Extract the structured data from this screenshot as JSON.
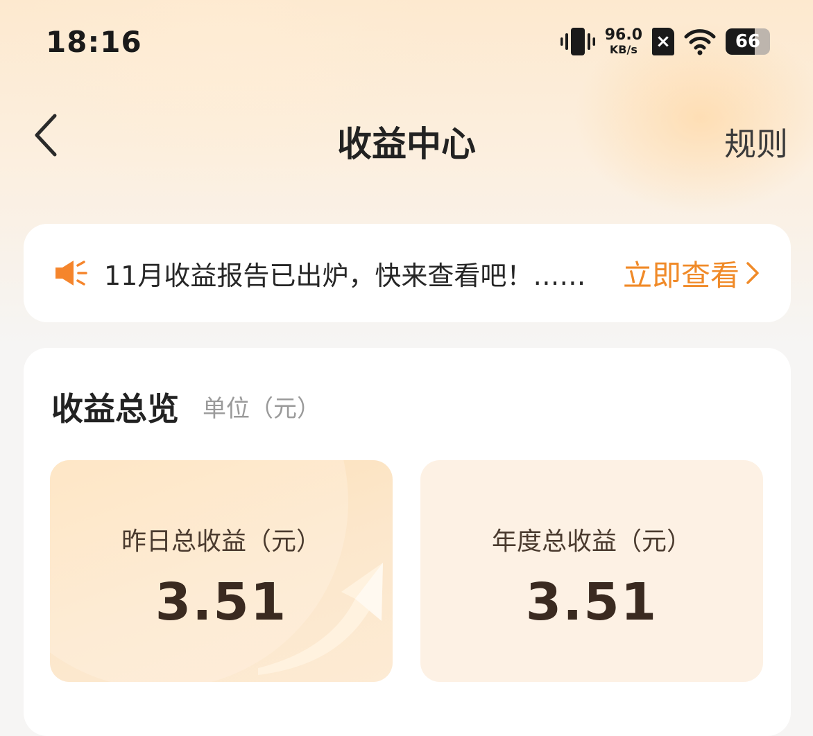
{
  "status_bar": {
    "time": "18:16",
    "net_speed_value": "96.0",
    "net_speed_unit": "KB/s",
    "battery_level": "66",
    "icons": [
      "vibrate-icon",
      "no-sim-icon",
      "wifi-icon",
      "battery-icon"
    ]
  },
  "header": {
    "title": "收益中心",
    "rules_label": "规则",
    "back_icon": "chevron-left-icon"
  },
  "notice": {
    "icon": "speaker-icon",
    "text": "11月收益报告已出炉，快来查看吧！……",
    "action_label": "立即查看",
    "action_icon": "chevron-right-icon"
  },
  "overview": {
    "title": "收益总览",
    "unit": "单位（元）",
    "stats": [
      {
        "label": "昨日总收益（元）",
        "value": "3.51"
      },
      {
        "label": "年度总收益（元）",
        "value": "3.51"
      }
    ]
  },
  "colors": {
    "accent": "#f08a28",
    "header_bg": "#fde9cf",
    "tile_primary": "#fde0b6",
    "tile_secondary": "#fdf1e4",
    "value_text": "#3a2a20"
  }
}
